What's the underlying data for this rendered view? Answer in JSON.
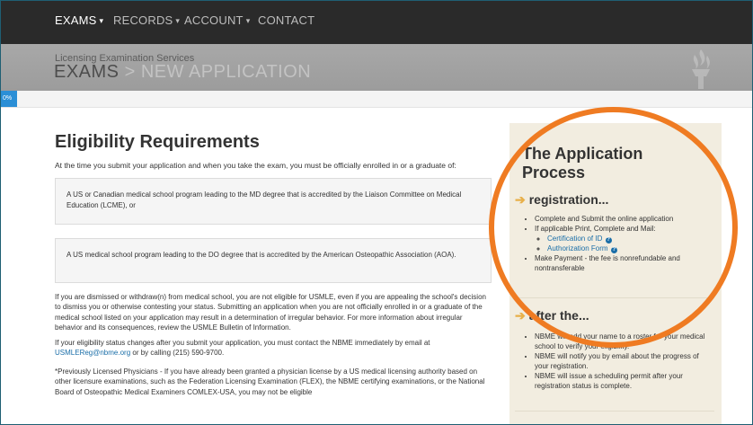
{
  "nav": {
    "items": [
      {
        "label": "EXAMS",
        "has_caret": true,
        "active": true
      },
      {
        "label": "RECORDS",
        "has_caret": true,
        "active": false
      },
      {
        "label": "ACCOUNT",
        "has_caret": true,
        "active": false
      },
      {
        "label": "CONTACT",
        "has_caret": false,
        "active": false
      }
    ],
    "caret": "▾"
  },
  "header": {
    "subtitle": "Licensing Examination Services",
    "crumb_active": "EXAMS",
    "crumb_separator": " > ",
    "crumb_current": "NEW APPLICATION"
  },
  "progress": {
    "label": "0%",
    "value": 0
  },
  "main": {
    "title": "Eligibility Requirements",
    "intro": "At the time you submit your application and when you take the exam, you must be officially enrolled in or a graduate of:",
    "box1": "A US or Canadian medical school program leading to the MD degree that is accredited by the Liaison Committee on Medical Education (LCME), or",
    "box2": "A US medical school program leading to the DO degree that is accredited by the American Osteopathic Association (AOA).",
    "para1": "If you are dismissed or withdraw(n) from medical school, you are not eligible for USMLE, even if you are appealing the school's decision to dismiss you or otherwise contesting your status. Submitting an application when you are not officially enrolled in or a graduate of the medical school listed on your application may result in a determination of irregular behavior. For more information about irregular behavior and its consequences, review the USMLE Bulletin of Information.",
    "para2_before": "If your eligibility status changes after you submit your application, you must contact the NBME immediately by email at ",
    "para2_email": "USMLEReg@nbme.org",
    "para2_after": " or by calling (215) 590-9700.",
    "para3": "*Previously Licensed Physicians - If you have already been granted a physician license by a US medical licensing authority based on other licensure examinations, such as the Federation Licensing Examination (FLEX), the NBME certifying examinations, or the National Board of Osteopathic Medical Examiners COMLEX-USA, you may not be eligible"
  },
  "sidebar": {
    "title": "The Application Process",
    "registration": {
      "heading": "registration...",
      "items": [
        "Complete and Submit the online application",
        "If applicable Print, Complete and Mail:",
        "Make Payment - the fee is nonrefundable and nontransferable"
      ],
      "sub_items": [
        "Certification of ID",
        "Authorization Form"
      ],
      "help_glyph": "?"
    },
    "after": {
      "heading": "after the...",
      "items": [
        "NBME will add your name to a roster for your medical school to verify your eligibility.",
        "NBME will notify you by email about the progress of your registration.",
        "NBME will issue a scheduling permit after your registration status is complete."
      ]
    },
    "arrow_glyph": "➔"
  },
  "colors": {
    "nav_bg": "#2a2a2a",
    "header_bg": "#a3a3a3",
    "progress": "#2b8fd6",
    "sidebar_bg": "#f2ede0",
    "highlight": "#ef7b22",
    "link": "#1a6ea8"
  }
}
